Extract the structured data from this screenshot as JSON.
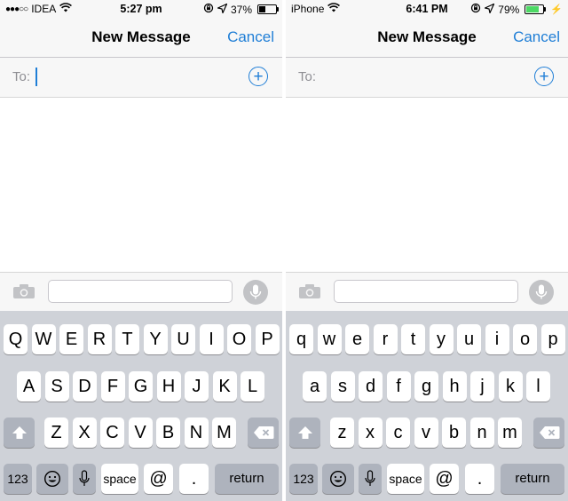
{
  "screens": [
    {
      "status": {
        "carrier": "IDEA",
        "signal_dots": "●●●○○",
        "time": "5:27 pm",
        "battery": "37%",
        "battery_level": 0.37,
        "battery_color": "#000000"
      },
      "nav": {
        "title": "New Message",
        "cancel": "Cancel"
      },
      "to_label": "To:",
      "add_icon": "+",
      "keys": {
        "row1": [
          "Q",
          "W",
          "E",
          "R",
          "T",
          "Y",
          "U",
          "I",
          "O",
          "P"
        ],
        "row2": [
          "A",
          "S",
          "D",
          "F",
          "G",
          "H",
          "J",
          "K",
          "L"
        ],
        "row3": [
          "Z",
          "X",
          "C",
          "V",
          "B",
          "N",
          "M"
        ],
        "numbers": "123",
        "space": "space",
        "at": "@",
        "dot": ".",
        "return": "return"
      }
    },
    {
      "status": {
        "carrier": "iPhone",
        "signal_dots": "",
        "time": "6:41 PM",
        "battery": "79%",
        "battery_level": 0.79,
        "battery_color": "#4cd964"
      },
      "nav": {
        "title": "New Message",
        "cancel": "Cancel"
      },
      "to_label": "To:",
      "add_icon": "+",
      "keys": {
        "row1": [
          "q",
          "w",
          "e",
          "r",
          "t",
          "y",
          "u",
          "i",
          "o",
          "p"
        ],
        "row2": [
          "a",
          "s",
          "d",
          "f",
          "g",
          "h",
          "j",
          "k",
          "l"
        ],
        "row3": [
          "z",
          "x",
          "c",
          "v",
          "b",
          "n",
          "m"
        ],
        "numbers": "123",
        "space": "space",
        "at": "@",
        "dot": ".",
        "return": "return"
      }
    }
  ],
  "icons": {
    "wifi": "wifi-icon",
    "lock_rotation": "orientation-lock-icon",
    "location": "location-arrow-icon",
    "camera": "camera-icon",
    "mic": "microphone-icon",
    "shift": "shift-icon",
    "delete": "delete-icon",
    "emoji": "emoji-icon",
    "dictation": "dictation-icon"
  }
}
